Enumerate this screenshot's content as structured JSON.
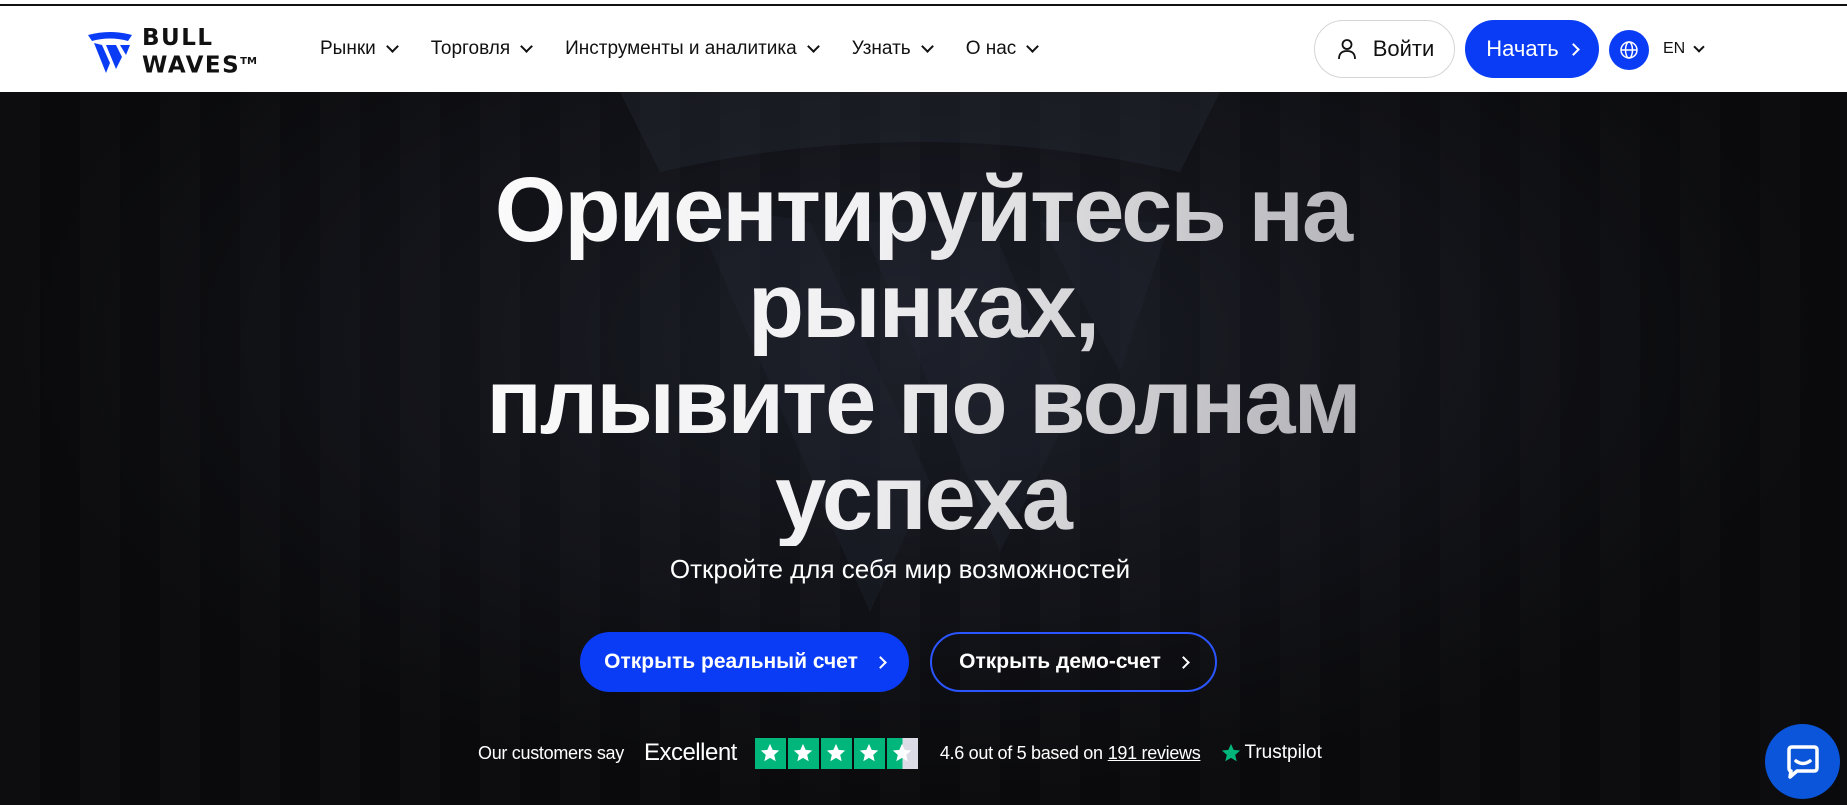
{
  "brand": {
    "line1": "BULL",
    "line2": "WAVES",
    "tm": "TM",
    "color": "#0a3cf5"
  },
  "nav": {
    "items": [
      {
        "label": "Рынки"
      },
      {
        "label": "Торговля"
      },
      {
        "label": "Инструменты и аналитика"
      },
      {
        "label": "Узнать"
      },
      {
        "label": "О нас"
      }
    ]
  },
  "header": {
    "login_label": "Войти",
    "start_label": "Начать",
    "language": "EN"
  },
  "hero": {
    "title_line1": "Ориентируйтесь на",
    "title_line2": "рынках,",
    "title_line3": "плывите по волнам",
    "title_line4": "успеха",
    "subtitle": "Откройте для себя мир возможностей",
    "cta_real": "Открыть реальный счет",
    "cta_demo": "Открыть демо-счет"
  },
  "trustpilot": {
    "intro": "Our customers say",
    "rating_word": "Excellent",
    "stars": 4.5,
    "rating_text": "4.6 out of 5 based on",
    "reviews_link": "191 reviews",
    "brand": "Trustpilot",
    "star_color": "#00b67a"
  }
}
